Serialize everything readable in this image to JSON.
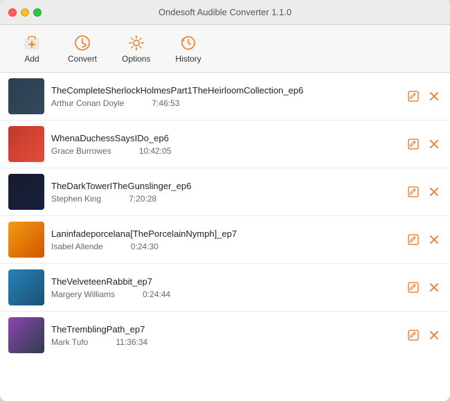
{
  "window": {
    "title": "Ondesoft Audible Converter 1.1.0"
  },
  "toolbar": {
    "buttons": [
      {
        "id": "add",
        "label": "Add",
        "icon": "➕"
      },
      {
        "id": "convert",
        "label": "Convert",
        "icon": "🔄"
      },
      {
        "id": "options",
        "label": "Options",
        "icon": "⚙"
      },
      {
        "id": "history",
        "label": "History",
        "icon": "🕐"
      }
    ]
  },
  "items": [
    {
      "id": 1,
      "title": "TheCompleteSherlockHolmesPart1TheHeirloomCollection_ep6",
      "author": "Arthur Conan Doyle",
      "duration": "7:46:53",
      "artClass": "art-1"
    },
    {
      "id": 2,
      "title": "WhenaDuchessSaysIDo_ep6",
      "author": "Grace Burrowes",
      "duration": "10:42:05",
      "artClass": "art-2"
    },
    {
      "id": 3,
      "title": "TheDarkTowerITheGunslinger_ep6",
      "author": "Stephen King",
      "duration": "7:20:28",
      "artClass": "art-3"
    },
    {
      "id": 4,
      "title": "Laninfadeporcelana[ThePorcelainNymph]_ep7",
      "author": "Isabel Allende",
      "duration": "0:24:30",
      "artClass": "art-4"
    },
    {
      "id": 5,
      "title": "TheVelveteenRabbit_ep7",
      "author": "Margery Williams",
      "duration": "0:24:44",
      "artClass": "art-5"
    },
    {
      "id": 6,
      "title": "TheTremblingPath_ep7",
      "author": "Mark Tufo",
      "duration": "11:36:34",
      "artClass": "art-6"
    }
  ],
  "actions": {
    "edit_icon": "✎",
    "delete_icon": "✕"
  }
}
